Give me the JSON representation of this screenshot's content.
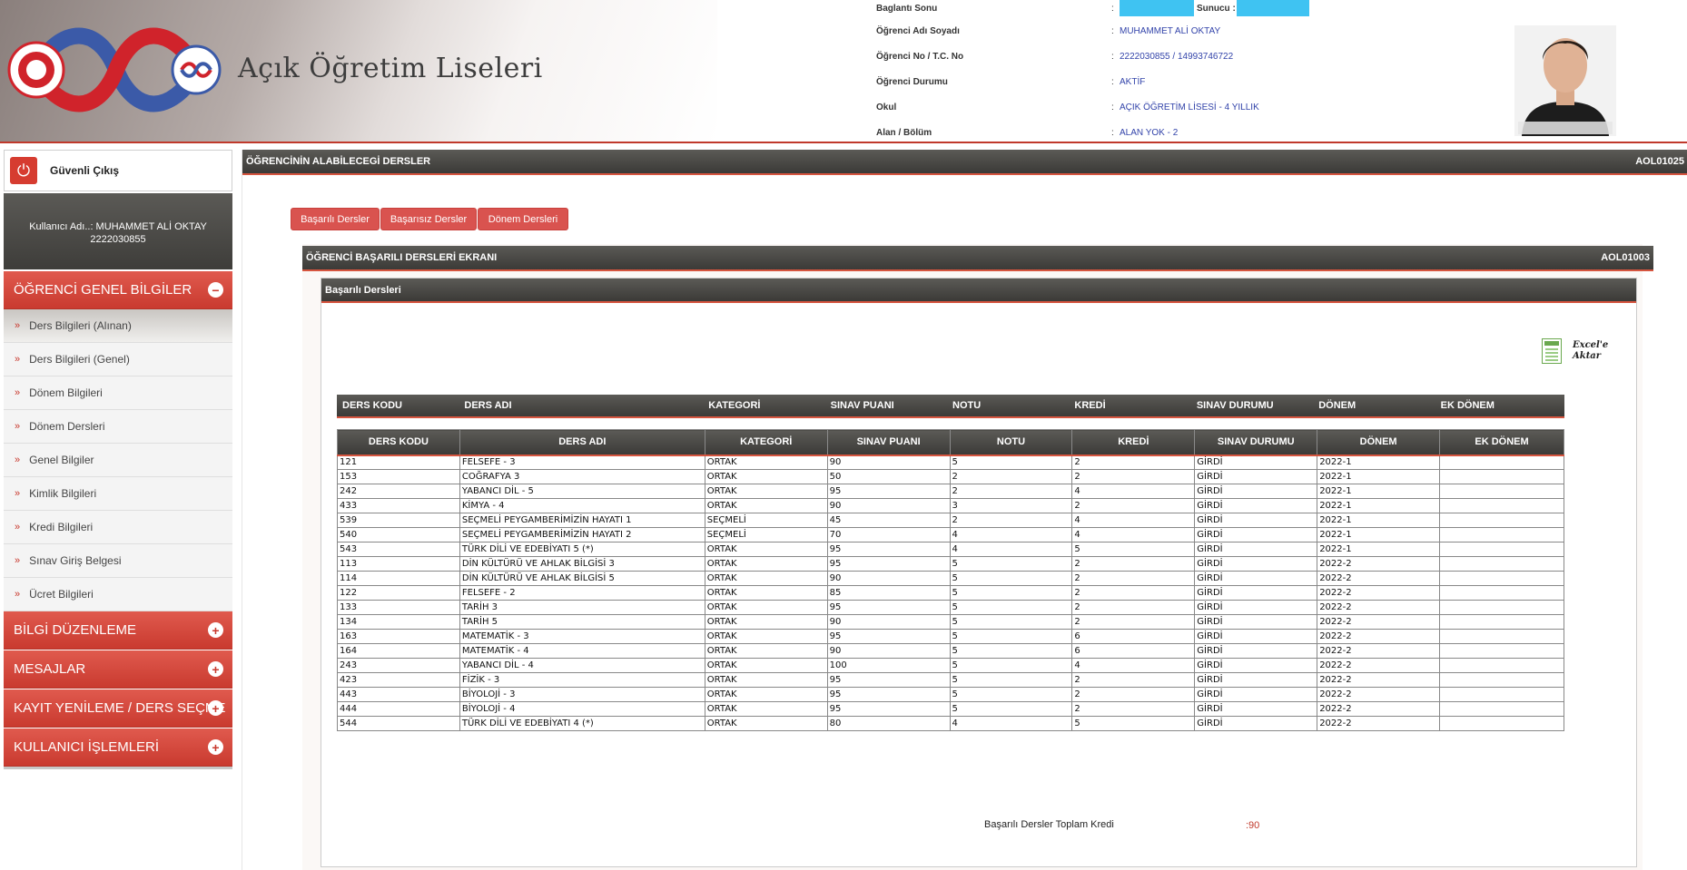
{
  "header": {
    "title": "Açık Öğretim Liseleri",
    "info": [
      {
        "label": "Baglantı Sonu",
        "value": ""
      },
      {
        "label": "Öğrenci Adı Soyadı",
        "value": "MUHAMMET ALİ OKTAY"
      },
      {
        "label": "Öğrenci No / T.C. No",
        "value": "2222030855 / 14993746722"
      },
      {
        "label": "Öğrenci Durumu",
        "value": "AKTİF"
      },
      {
        "label": "Okul",
        "value": "AÇIK ÖĞRETİM LİSESİ - 4 YILLIK"
      },
      {
        "label": "Alan / Bölüm",
        "value": "ALAN YOK - 2"
      }
    ],
    "server_label": "Sunucu :"
  },
  "sidebar": {
    "logout_label": "Güvenli Çıkış",
    "user_line1": "Kullanıcı Adı..: MUHAMMET ALİ OKTAY",
    "user_line2": "2222030855",
    "sections": [
      {
        "label": "ÖĞRENCİ GENEL BİLGİLER",
        "icon": "minus-icon",
        "expanded": true
      },
      {
        "label": "BİLGİ DÜZENLEME",
        "icon": "plus-icon"
      },
      {
        "label": "MESAJLAR",
        "icon": "plus-icon"
      },
      {
        "label": "KAYIT YENİLEME / DERS SEÇME",
        "icon": "plus-icon"
      },
      {
        "label": "KULLANICI İŞLEMLERİ",
        "icon": "plus-icon"
      }
    ],
    "subitems": [
      {
        "label": "Ders Bilgileri (Alınan)",
        "active": true
      },
      {
        "label": "Ders Bilgileri (Genel)"
      },
      {
        "label": "Dönem Bilgileri"
      },
      {
        "label": "Dönem Dersleri"
      },
      {
        "label": "Genel Bilgiler"
      },
      {
        "label": "Kimlik Bilgileri"
      },
      {
        "label": "Kredi Bilgileri"
      },
      {
        "label": "Sınav Giriş Belgesi"
      },
      {
        "label": "Ücret Bilgileri"
      }
    ]
  },
  "main": {
    "title": "ÖĞRENCİNİN ALABİLECEGİ DERSLER",
    "code": "AOL01025",
    "tabs": [
      "Başarılı Dersler",
      "Başarısız Dersler",
      "Dönem Dersleri"
    ],
    "screen_title": "ÖĞRENCİ BAŞARILI DERSLERİ EKRANI",
    "screen_code": "AOL01003",
    "panel_title": "Başarılı Dersleri",
    "excel_line1": "Excel'e",
    "excel_line2": "Aktar",
    "columns": [
      "DERS KODU",
      "DERS ADI",
      "KATEGORİ",
      "SINAV PUANI",
      "NOTU",
      "KREDİ",
      "SINAV DURUMU",
      "DÖNEM",
      "EK DÖNEM"
    ],
    "rows": [
      [
        "121",
        "FELSEFE - 3",
        "ORTAK",
        "90",
        "5",
        "2",
        "GİRDİ",
        "2022-1",
        ""
      ],
      [
        "153",
        "COĞRAFYA 3",
        "ORTAK",
        "50",
        "2",
        "2",
        "GİRDİ",
        "2022-1",
        ""
      ],
      [
        "242",
        "YABANCI DİL - 5",
        "ORTAK",
        "95",
        "2",
        "4",
        "GİRDİ",
        "2022-1",
        ""
      ],
      [
        "433",
        "KİMYA - 4",
        "ORTAK",
        "90",
        "3",
        "2",
        "GİRDİ",
        "2022-1",
        ""
      ],
      [
        "539",
        "SEÇMELİ PEYGAMBERİMİZİN HAYATI 1",
        "SEÇMELİ",
        "45",
        "2",
        "4",
        "GİRDİ",
        "2022-1",
        ""
      ],
      [
        "540",
        "SEÇMELİ PEYGAMBERİMİZİN HAYATI 2",
        "SEÇMELİ",
        "70",
        "4",
        "4",
        "GİRDİ",
        "2022-1",
        ""
      ],
      [
        "543",
        "TÜRK DİLİ VE EDEBİYATI 5 (*)",
        "ORTAK",
        "95",
        "4",
        "5",
        "GİRDİ",
        "2022-1",
        ""
      ],
      [
        "113",
        "DİN KÜLTÜRÜ VE AHLAK BİLGİSİ 3",
        "ORTAK",
        "95",
        "5",
        "2",
        "GİRDİ",
        "2022-2",
        ""
      ],
      [
        "114",
        "DİN KÜLTÜRÜ VE AHLAK BİLGİSİ 5",
        "ORTAK",
        "90",
        "5",
        "2",
        "GİRDİ",
        "2022-2",
        ""
      ],
      [
        "122",
        "FELSEFE - 2",
        "ORTAK",
        "85",
        "5",
        "2",
        "GİRDİ",
        "2022-2",
        ""
      ],
      [
        "133",
        "TARİH 3",
        "ORTAK",
        "95",
        "5",
        "2",
        "GİRDİ",
        "2022-2",
        ""
      ],
      [
        "134",
        "TARİH 5",
        "ORTAK",
        "90",
        "5",
        "2",
        "GİRDİ",
        "2022-2",
        ""
      ],
      [
        "163",
        "MATEMATİK - 3",
        "ORTAK",
        "95",
        "5",
        "6",
        "GİRDİ",
        "2022-2",
        ""
      ],
      [
        "164",
        "MATEMATİK - 4",
        "ORTAK",
        "90",
        "5",
        "6",
        "GİRDİ",
        "2022-2",
        ""
      ],
      [
        "243",
        "YABANCI DİL - 4",
        "ORTAK",
        "100",
        "5",
        "4",
        "GİRDİ",
        "2022-2",
        ""
      ],
      [
        "423",
        "FİZİK - 3",
        "ORTAK",
        "95",
        "5",
        "2",
        "GİRDİ",
        "2022-2",
        ""
      ],
      [
        "443",
        "BİYOLOJİ - 3",
        "ORTAK",
        "95",
        "5",
        "2",
        "GİRDİ",
        "2022-2",
        ""
      ],
      [
        "444",
        "BİYOLOJİ - 4",
        "ORTAK",
        "95",
        "5",
        "2",
        "GİRDİ",
        "2022-2",
        ""
      ],
      [
        "544",
        "TÜRK DİLİ VE EDEBİYATI 4 (*)",
        "ORTAK",
        "80",
        "4",
        "5",
        "GİRDİ",
        "2022-2",
        ""
      ]
    ],
    "total_label": "Başarılı Dersler Toplam Kredi",
    "total_value": ":90"
  },
  "colors": {
    "accent": "#d9534f",
    "dark": "#3b3a37",
    "link": "#3344aa",
    "server_box": "#3fc3f2"
  }
}
